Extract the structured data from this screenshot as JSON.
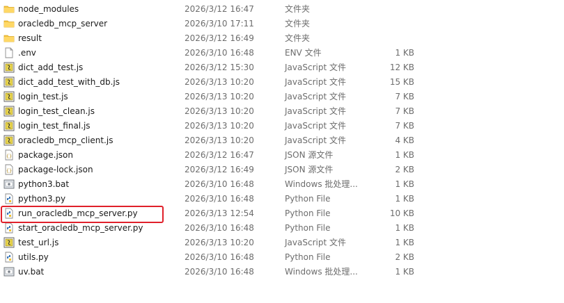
{
  "files": [
    {
      "name": "node_modules",
      "date": "2026/3/12 16:47",
      "type": "文件夹",
      "size": "",
      "icon": "folder-icon"
    },
    {
      "name": "oracledb_mcp_server",
      "date": "2026/3/10 17:11",
      "type": "文件夹",
      "size": "",
      "icon": "folder-icon"
    },
    {
      "name": "result",
      "date": "2026/3/12 16:49",
      "type": "文件夹",
      "size": "",
      "icon": "folder-icon"
    },
    {
      "name": ".env",
      "date": "2026/3/10 16:48",
      "type": "ENV 文件",
      "size": "1 KB",
      "icon": "blank-file-icon"
    },
    {
      "name": "dict_add_test.js",
      "date": "2026/3/12 15:30",
      "type": "JavaScript 文件",
      "size": "12 KB",
      "icon": "js-file-icon"
    },
    {
      "name": "dict_add_test_with_db.js",
      "date": "2026/3/13 10:20",
      "type": "JavaScript 文件",
      "size": "15 KB",
      "icon": "js-file-icon"
    },
    {
      "name": "login_test.js",
      "date": "2026/3/13 10:20",
      "type": "JavaScript 文件",
      "size": "7 KB",
      "icon": "js-file-icon"
    },
    {
      "name": "login_test_clean.js",
      "date": "2026/3/13 10:20",
      "type": "JavaScript 文件",
      "size": "7 KB",
      "icon": "js-file-icon"
    },
    {
      "name": "login_test_final.js",
      "date": "2026/3/13 10:20",
      "type": "JavaScript 文件",
      "size": "7 KB",
      "icon": "js-file-icon"
    },
    {
      "name": "oracledb_mcp_client.js",
      "date": "2026/3/13 10:20",
      "type": "JavaScript 文件",
      "size": "4 KB",
      "icon": "js-file-icon"
    },
    {
      "name": "package.json",
      "date": "2026/3/12 16:47",
      "type": "JSON 源文件",
      "size": "1 KB",
      "icon": "json-file-icon"
    },
    {
      "name": "package-lock.json",
      "date": "2026/3/12 16:49",
      "type": "JSON 源文件",
      "size": "2 KB",
      "icon": "json-file-icon"
    },
    {
      "name": "python3.bat",
      "date": "2026/3/10 16:48",
      "type": "Windows 批处理...",
      "size": "1 KB",
      "icon": "bat-file-icon"
    },
    {
      "name": "python3.py",
      "date": "2026/3/10 16:48",
      "type": "Python File",
      "size": "1 KB",
      "icon": "python-file-icon"
    },
    {
      "name": "run_oracledb_mcp_server.py",
      "date": "2026/3/13 12:54",
      "type": "Python File",
      "size": "10 KB",
      "icon": "python-file-icon"
    },
    {
      "name": "start_oracledb_mcp_server.py",
      "date": "2026/3/10 16:48",
      "type": "Python File",
      "size": "1 KB",
      "icon": "python-file-icon"
    },
    {
      "name": "test_url.js",
      "date": "2026/3/13 10:20",
      "type": "JavaScript 文件",
      "size": "1 KB",
      "icon": "js-file-icon"
    },
    {
      "name": "utils.py",
      "date": "2026/3/10 16:48",
      "type": "Python File",
      "size": "2 KB",
      "icon": "python-file-icon"
    },
    {
      "name": "uv.bat",
      "date": "2026/3/10 16:48",
      "type": "Windows 批处理...",
      "size": "1 KB",
      "icon": "bat-file-icon"
    }
  ],
  "colors": {
    "highlight_border": "#e0202a",
    "folder": "#f5c542",
    "js_badge": "#e8d44d",
    "python_blue": "#3b77b8"
  }
}
